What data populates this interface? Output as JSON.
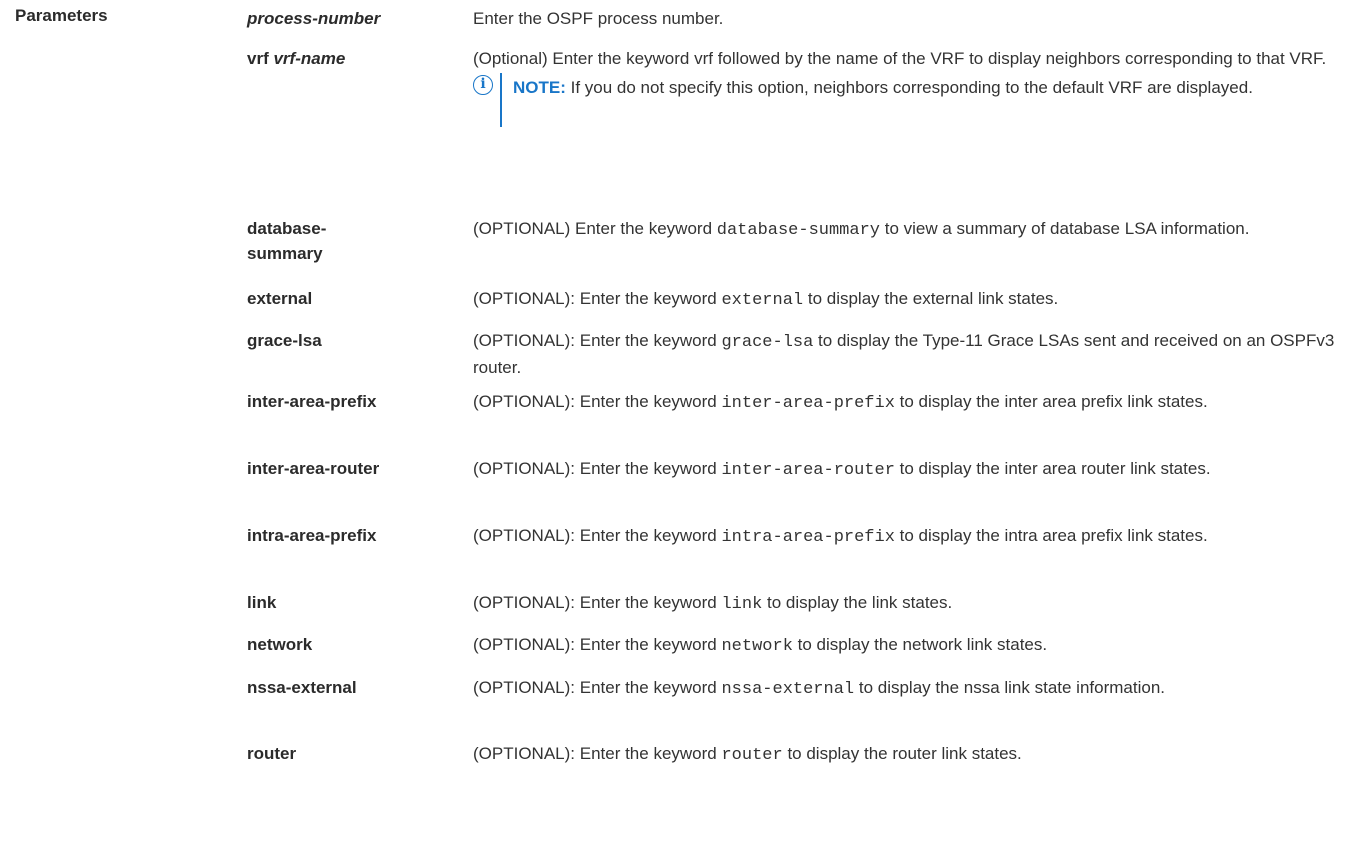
{
  "section_label": "Parameters",
  "params": [
    {
      "term": "process-number",
      "desc": "Enter the OSPF process number."
    },
    {
      "term_kw": "vrf",
      "term_arg": "vrf-name",
      "desc": "(Optional) Enter the keyword vrf followed by the name of the VRF to display neighbors corresponding to that VRF.",
      "note_label": "NOTE:",
      "note_text": "If you do not specify this option, neighbors corresponding to the default VRF are displayed."
    },
    {
      "term": "database-summary",
      "desc_pre": "(OPTIONAL) Enter the keyword",
      "code": "database-summary",
      "desc_post": "to view a summary of database LSA information."
    },
    {
      "term": "external",
      "desc_pre": "(OPTIONAL): Enter the keyword",
      "code": "external",
      "desc_post": "to display the external link states."
    },
    {
      "term": "grace-lsa",
      "desc_pre": "(OPTIONAL): Enter the keyword",
      "code": "grace-lsa",
      "desc_post": "to display the Type-11 Grace LSAs sent and received on an OSPFv3 router."
    },
    {
      "term": "inter-area-prefix",
      "desc_pre": "(OPTIONAL): Enter the keyword",
      "code": "inter-area-prefix",
      "desc_post": "to display the inter area prefix link states."
    },
    {
      "term": "inter-area-router",
      "desc_pre": "(OPTIONAL): Enter the keyword",
      "code": "inter-area-router",
      "desc_post": "to display the inter area router link states."
    },
    {
      "term": "intra-area-prefix",
      "desc_pre": "(OPTIONAL): Enter the keyword",
      "code": "intra-area-prefix",
      "desc_post": "to display the intra area prefix link states."
    },
    {
      "term": "link",
      "desc_pre": "(OPTIONAL): Enter the keyword",
      "code": "link",
      "desc_post": "to display the link states."
    },
    {
      "term": "network",
      "desc_pre": "(OPTIONAL): Enter the keyword",
      "code": "network",
      "desc_post": "to display the network link states."
    },
    {
      "term": "nssa-external",
      "desc_pre": "(OPTIONAL): Enter the keyword",
      "code": "nssa-external",
      "desc_post": "to display the nssa link state information."
    },
    {
      "term": "router",
      "desc_pre": "(OPTIONAL): Enter the keyword",
      "code": "router",
      "desc_post": "to display the router link states."
    }
  ],
  "icons": {
    "note": "info-icon"
  },
  "colors": {
    "note_accent": "#1976c8",
    "text": "#333333"
  }
}
